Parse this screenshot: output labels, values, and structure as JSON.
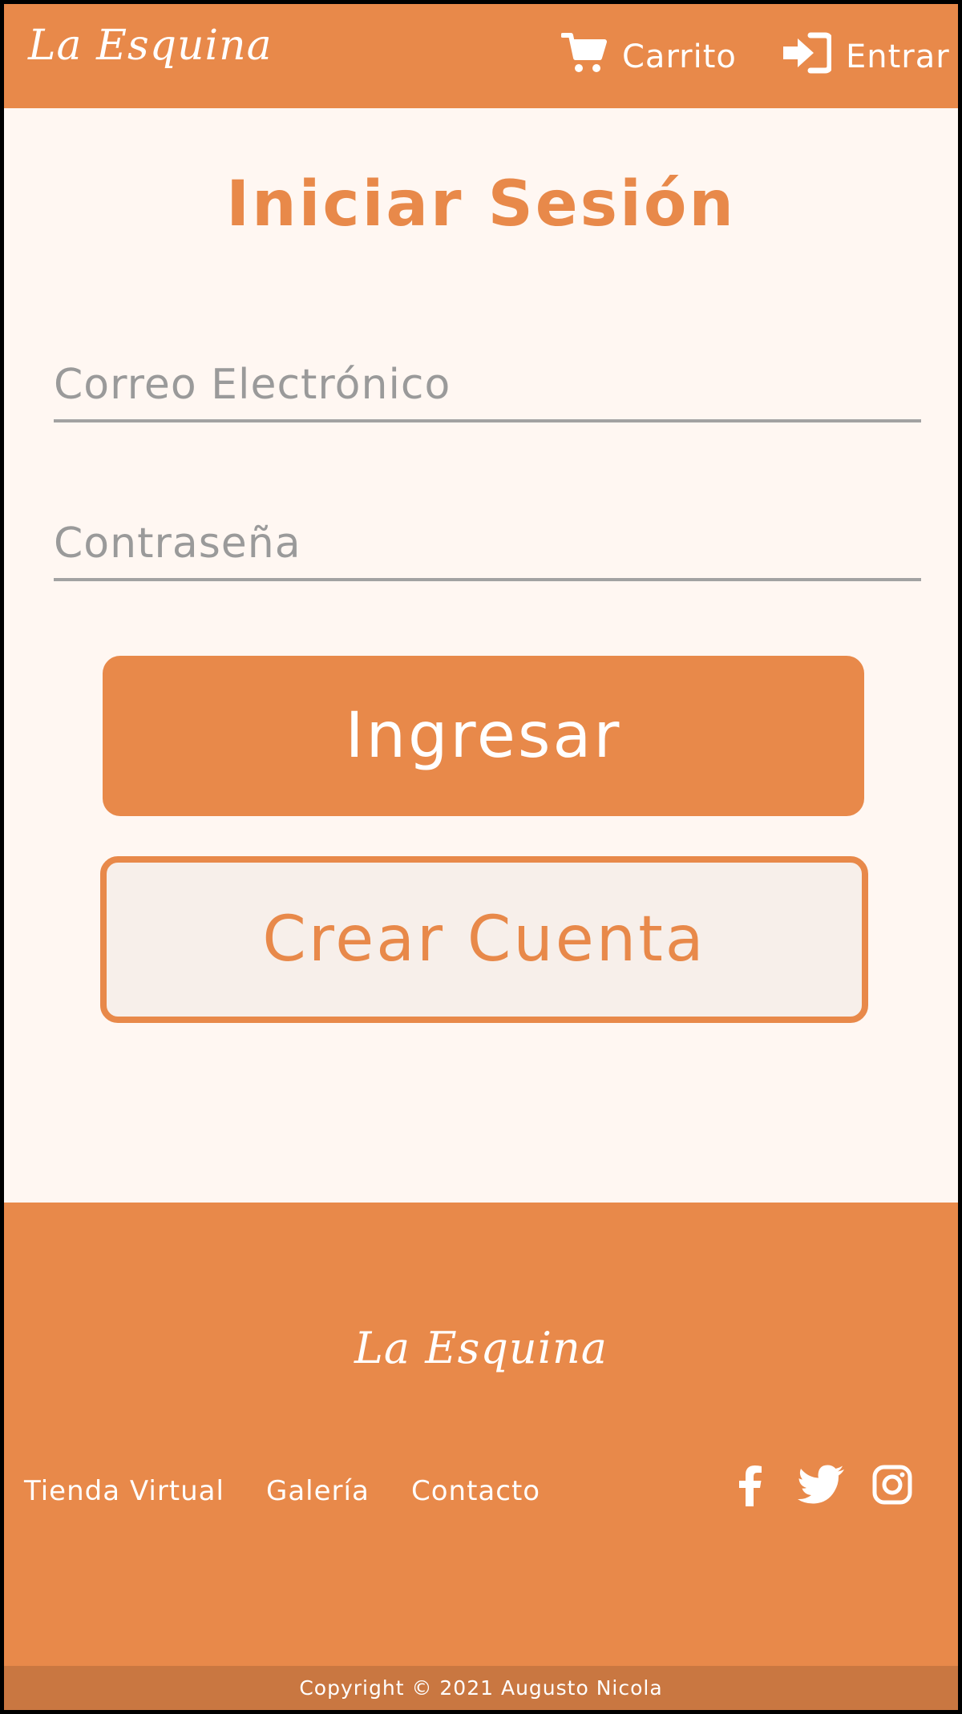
{
  "header": {
    "logo": "La Esquina",
    "cart_label": "Carrito",
    "login_label": "Entrar"
  },
  "main": {
    "title": "Iniciar Sesión",
    "email_placeholder": "Correo Electrónico",
    "password_placeholder": "Contraseña",
    "login_button": "Ingresar",
    "register_button": "Crear Cuenta"
  },
  "footer": {
    "logo": "La Esquina",
    "links": [
      "Tienda Virtual",
      "Galería",
      "Contacto"
    ],
    "social_icons": [
      "facebook-icon",
      "twitter-icon",
      "instagram-icon"
    ],
    "copyright": "Copyright © 2021 Augusto Nicola"
  },
  "colors": {
    "brand_orange": "#e8894a",
    "page_background": "#fff7f2",
    "copyright_bar": "#c97741",
    "field_underline": "#a2a2a2"
  }
}
